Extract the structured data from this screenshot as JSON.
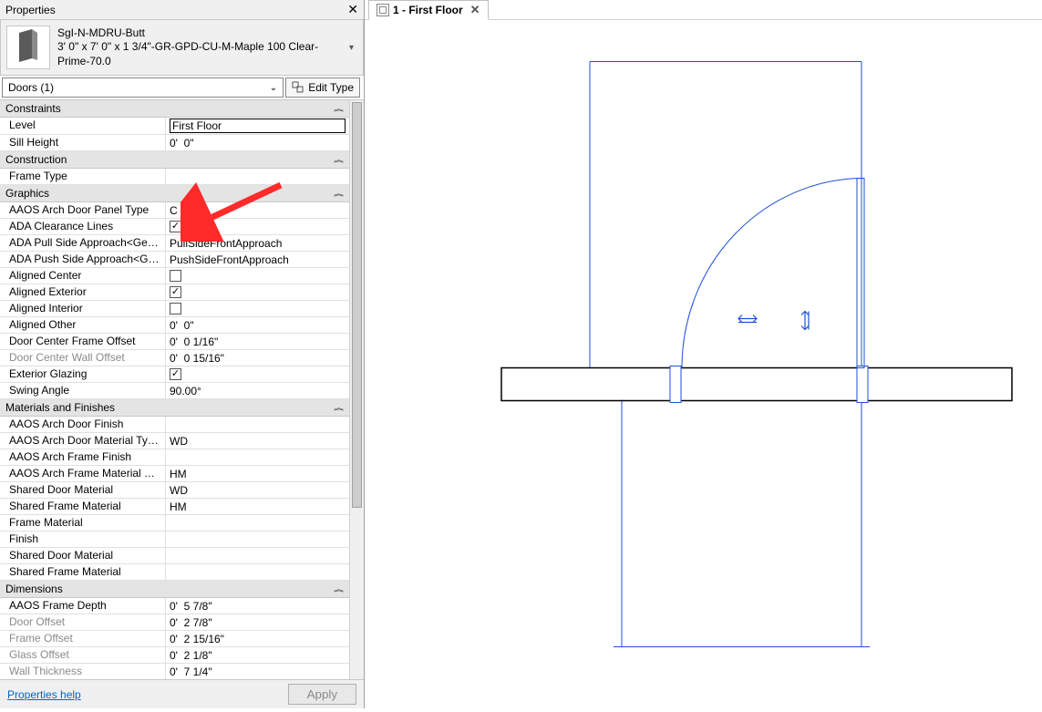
{
  "panel": {
    "title": "Properties"
  },
  "type": {
    "name": "SgI-N-MDRU-Butt",
    "size": "3' 0\" x 7' 0\" x 1 3/4\"-GR-GPD-CU-M-Maple 100 Clear-Prime-70.0"
  },
  "filter": {
    "text": "Doors (1)"
  },
  "editType": {
    "label": "Edit Type"
  },
  "categories": [
    {
      "name": "Constraints",
      "rows": [
        {
          "label": "Level",
          "value": "First Floor",
          "kind": "text",
          "boxed": true
        },
        {
          "label": "Sill Height",
          "value": "0'  0\"",
          "kind": "text"
        }
      ]
    },
    {
      "name": "Construction",
      "rows": [
        {
          "label": "Frame Type",
          "value": "",
          "kind": "text"
        }
      ]
    },
    {
      "name": "Graphics",
      "rows": [
        {
          "label": "AAOS Arch Door Panel Type",
          "value": "C",
          "kind": "text"
        },
        {
          "label": "ADA Clearance Lines",
          "value": true,
          "kind": "check"
        },
        {
          "label": "ADA Pull Side Approach<Gene...",
          "value": "PullSideFrontApproach",
          "kind": "text"
        },
        {
          "label": "ADA Push Side Approach<Gen...",
          "value": "PushSideFrontApproach",
          "kind": "text"
        },
        {
          "label": "Aligned Center",
          "value": false,
          "kind": "check"
        },
        {
          "label": "Aligned Exterior",
          "value": true,
          "kind": "check"
        },
        {
          "label": "Aligned Interior",
          "value": false,
          "kind": "check"
        },
        {
          "label": "Aligned Other",
          "value": "0'  0\"",
          "kind": "text"
        },
        {
          "label": "Door Center Frame Offset",
          "value": "0'  0 1/16\"",
          "kind": "text"
        },
        {
          "label": "Door Center Wall Offset",
          "value": "0'  0 15/16\"",
          "kind": "text",
          "ro": true
        },
        {
          "label": "Exterior Glazing",
          "value": true,
          "kind": "check"
        },
        {
          "label": "Swing Angle",
          "value": "90.00°",
          "kind": "text"
        }
      ]
    },
    {
      "name": "Materials and Finishes",
      "rows": [
        {
          "label": "AAOS Arch Door Finish",
          "value": "",
          "kind": "text"
        },
        {
          "label": "AAOS Arch Door Material Type",
          "value": "WD",
          "kind": "text"
        },
        {
          "label": "AAOS Arch Frame Finish",
          "value": "",
          "kind": "text"
        },
        {
          "label": "AAOS Arch Frame Material Type",
          "value": "HM",
          "kind": "text"
        },
        {
          "label": "Shared Door Material",
          "value": "WD",
          "kind": "text"
        },
        {
          "label": "Shared Frame Material",
          "value": "HM",
          "kind": "text"
        },
        {
          "label": "Frame Material",
          "value": "",
          "kind": "text"
        },
        {
          "label": "Finish",
          "value": "",
          "kind": "text"
        },
        {
          "label": "Shared Door Material",
          "value": "",
          "kind": "text"
        },
        {
          "label": "Shared Frame Material",
          "value": "",
          "kind": "text"
        }
      ]
    },
    {
      "name": "Dimensions",
      "rows": [
        {
          "label": "AAOS Frame Depth",
          "value": "0'  5 7/8\"",
          "kind": "text"
        },
        {
          "label": "Door Offset",
          "value": "0'  2 7/8\"",
          "kind": "text",
          "ro": true
        },
        {
          "label": "Frame Offset",
          "value": "0'  2 15/16\"",
          "kind": "text",
          "ro": true
        },
        {
          "label": "Glass Offset",
          "value": "0'  2 1/8\"",
          "kind": "text",
          "ro": true
        },
        {
          "label": "Wall Thickness",
          "value": "0'  7 1/4\"",
          "kind": "text",
          "ro": true
        }
      ]
    }
  ],
  "footer": {
    "help": "Properties help",
    "apply": "Apply"
  },
  "view": {
    "tab": "1 - First Floor"
  },
  "colors": {
    "blueprint": "#1f4fd8",
    "arrow": "#ff2a2a"
  },
  "icons": {
    "close": "✕",
    "chevron_down": "⌄",
    "dbl_up": "︽"
  }
}
